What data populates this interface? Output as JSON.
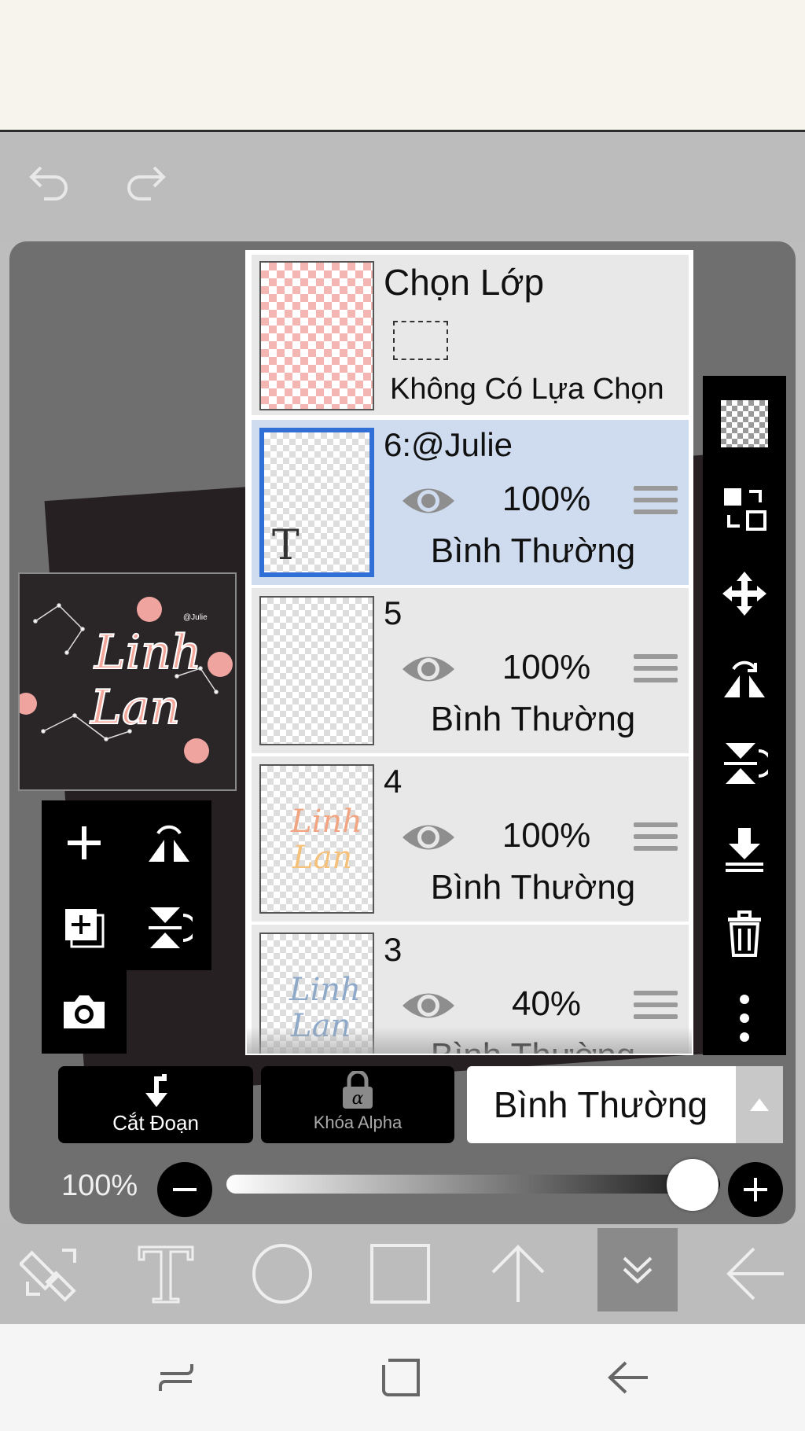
{
  "layer_panel": {
    "selection": {
      "title": "Chọn Lớp",
      "status": "Không Có Lựa Chọn"
    },
    "layers": [
      {
        "name": "6:@Julie",
        "opacity": "100%",
        "blend": "Bình Thường",
        "selected": true,
        "thumb_glyph": "T"
      },
      {
        "name": "5",
        "opacity": "100%",
        "blend": "Bình Thường",
        "selected": false
      },
      {
        "name": "4",
        "opacity": "100%",
        "blend": "Bình Thường",
        "selected": false
      },
      {
        "name": "3",
        "opacity": "40%",
        "blend": "Bình Thường",
        "selected": false
      }
    ]
  },
  "actions": {
    "clipping_label": "Cắt Đoạn",
    "alpha_lock_label": "Khóa Alpha",
    "blend_mode_value": "Bình Thường"
  },
  "opacity": {
    "label": "100%",
    "value": 1.0
  },
  "thumbnail_text": {
    "line1": "Linh",
    "line2": "Lan",
    "handle": "@Julie"
  },
  "icons": {
    "top": [
      "undo-icon",
      "redo-icon"
    ],
    "right_tools": [
      "checker-icon",
      "swap-layer-icon",
      "move-icon",
      "flip-h-icon",
      "flip-v-icon",
      "merge-down-icon",
      "trash-icon",
      "more-icon"
    ],
    "left_tools": [
      "add-layer-icon",
      "flip-h-icon",
      "add-copy-icon",
      "flip-v-icon",
      "camera-icon"
    ],
    "bottom": [
      "transform-icon",
      "text-icon",
      "circle-icon",
      "square-icon",
      "arrow-up-icon",
      "collapse-icon",
      "back-arrow-icon"
    ],
    "nav": [
      "recent-apps-icon",
      "home-icon",
      "back-icon"
    ]
  },
  "colors": {
    "selected_row": "#cfdcef",
    "selected_border": "#2f6fd6",
    "pink_text": "#f2a39a"
  }
}
